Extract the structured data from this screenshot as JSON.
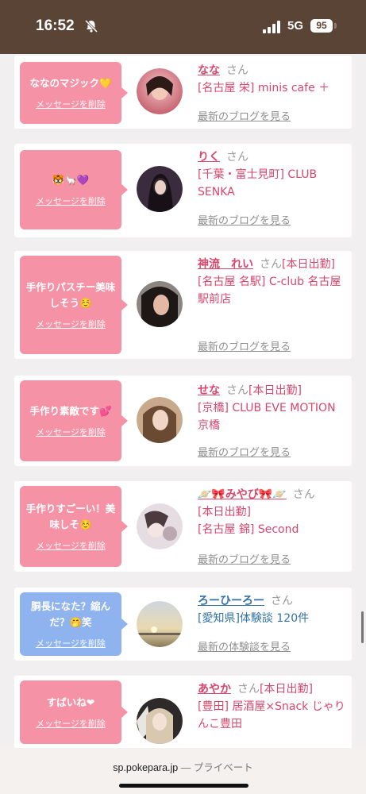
{
  "status_bar": {
    "time": "16:52",
    "network": "5G",
    "battery": "95"
  },
  "cards": [
    {
      "message": "ななのマジック💛",
      "delete_label": "メッセージを削除",
      "bubble_color": "pink",
      "name": "なな",
      "san": "さん",
      "status": "",
      "shop": "[名古屋 栄] minis cafe ＋",
      "link": "最新のブログを見る"
    },
    {
      "message": "🐯🦙💜",
      "delete_label": "メッセージを削除",
      "bubble_color": "pink",
      "name": "りく",
      "san": "さん",
      "status": "",
      "shop": "[千葉・富士見町] CLUB SENKA",
      "link": "最新のブログを見る"
    },
    {
      "message": "手作りパスチー美味しそう☺️",
      "delete_label": "メッセージを削除",
      "bubble_color": "pink",
      "name": "神流　れい",
      "san": "さん",
      "status": "[本日出勤]",
      "shop": "[名古屋 名駅] C-club 名古屋駅前店",
      "link": "最新のブログを見る"
    },
    {
      "message": "手作り素敵です💕",
      "delete_label": "メッセージを削除",
      "bubble_color": "pink",
      "name": "せな",
      "san": "さん",
      "status": "[本日出勤]",
      "shop": "[京橋] CLUB EVE MOTION 京橋",
      "link": "最新のブログを見る"
    },
    {
      "message": "手作りすごーい！美味しそ☺️",
      "delete_label": "メッセージを削除",
      "bubble_color": "pink",
      "name": "🪐🎀みやび🎀🪐",
      "san": "さん",
      "status": "[本日出勤]",
      "shop": "[名古屋 錦] Second",
      "link": "最新のブログを見る"
    },
    {
      "message": "胴長になた？縮んだ？🤭笑",
      "delete_label": "メッセージを削除",
      "bubble_color": "blue",
      "name": "ろーひーろー",
      "san": "さん",
      "status": "",
      "shop": "[愛知県]体験談 120件",
      "link": "最新の体験談を見る"
    },
    {
      "message": "すばいね❤",
      "delete_label": "メッセージを削除",
      "bubble_color": "pink",
      "name": "あやか",
      "san": "さん",
      "status": "[本日出勤]",
      "shop": "[豊田] 居酒屋×Snack じゃりんこ豊田",
      "link": ""
    }
  ],
  "bottom_bar": {
    "domain": "sp.pokepara.jp",
    "separator": "—",
    "mode": "プライベート"
  }
}
